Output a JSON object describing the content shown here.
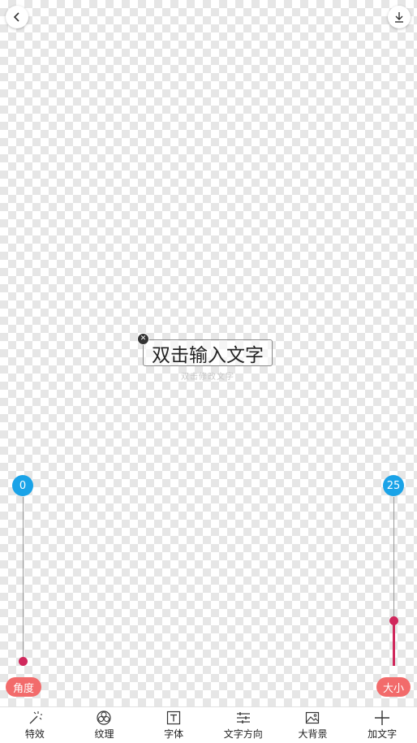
{
  "canvas": {
    "text_box": {
      "text": "双击输入文字",
      "close_glyph": "✕"
    },
    "hint": "双击修改文字"
  },
  "icons": {
    "back": "chevron-left-icon",
    "download": "download-icon",
    "effects": "magic-wand-icon",
    "texture": "flower-icon",
    "font": "font-icon",
    "direction": "sliders-icon",
    "background": "image-icon",
    "add_text": "plus-icon"
  },
  "sliders": {
    "angle": {
      "value": "0",
      "label": "角度",
      "level": 0
    },
    "size": {
      "value": "25",
      "label": "大小",
      "level": 0.25
    }
  },
  "toolbar": {
    "items": [
      {
        "label": "特效"
      },
      {
        "label": "纹理"
      },
      {
        "label": "字体"
      },
      {
        "label": "文字方向"
      },
      {
        "label": "大背景"
      },
      {
        "label": "加文字"
      }
    ]
  },
  "colors": {
    "accent_blue": "#1aa3e8",
    "thumb_red": "#d0285c",
    "label_red": "#f26b6b"
  }
}
